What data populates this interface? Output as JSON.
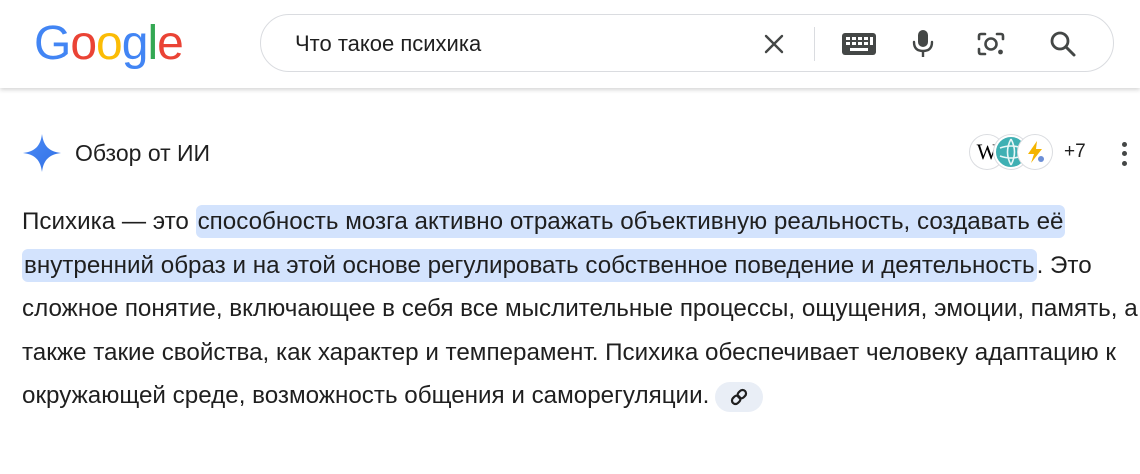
{
  "header": {
    "logo": {
      "letters": [
        "G",
        "o",
        "o",
        "g",
        "l",
        "e"
      ],
      "colors": [
        "#4285F4",
        "#EA4335",
        "#FBBC05",
        "#4285F4",
        "#34A853",
        "#EA4335"
      ]
    },
    "search": {
      "value": "Что такое психика",
      "icons": [
        "close-icon",
        "keyboard-icon",
        "microphone-icon",
        "camera-lens-icon",
        "search-icon"
      ]
    }
  },
  "ai_overview": {
    "title": "Обзор от ИИ",
    "sources": {
      "icons": [
        "wikipedia-icon",
        "globe-icon",
        "lightning-icon"
      ],
      "more_count": "+7"
    },
    "paragraph": {
      "lead": "Психика — это ",
      "highlight": "способность мозга активно отражать объективную реальность, создавать её внутренний образ и на этой основе регулировать собственное поведение и деятельность",
      "rest": ". Это сложное понятие, включающее в себя все мыслительные процессы, ощущения, эмоции, память, а также такие свойства, как характер и темперамент. Психика обеспечивает человеку адаптацию к окружающей среде, возможность общения и саморегуляции."
    },
    "link_icon": "link-icon"
  },
  "colors": {
    "highlight": "#d3e3fd",
    "text": "#1f1f1f",
    "chip": "#e9eef6",
    "icon": "#444746"
  }
}
